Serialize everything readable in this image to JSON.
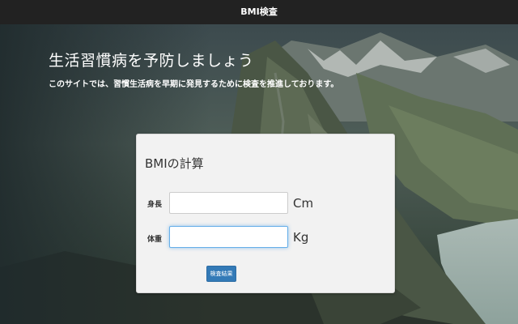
{
  "navbar": {
    "title": "BMI検査"
  },
  "hero": {
    "title": "生活習慣病を予防しましょう",
    "subtitle": "このサイトでは、習慣生活病を早期に発見するために検査を推進しております。"
  },
  "bmi_form": {
    "title": "BMIの計算",
    "height": {
      "label": "身長",
      "value": "",
      "placeholder": "",
      "unit": "Cm"
    },
    "weight": {
      "label": "体重",
      "value": "",
      "placeholder": "",
      "unit": "Kg"
    },
    "submit_label": "検査結果"
  },
  "colors": {
    "navbar_bg": "#222222",
    "button_bg": "#337ab7",
    "focus_ring": "#66afe9",
    "panel_bg": "#f2f2f2"
  }
}
